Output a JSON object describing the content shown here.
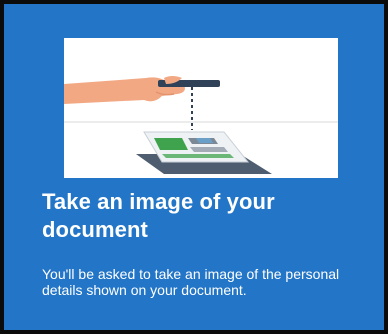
{
  "screen": {
    "title": "Take an image of your document",
    "description": "You'll be asked to take an image of the personal details shown on your document."
  },
  "illustration": {
    "icon": "hand-holding-phone-over-document-icon"
  },
  "colors": {
    "background": "#2275c7",
    "frame_border": "#0b0b0b",
    "text": "#ffffff",
    "skin": "#f2a983",
    "phone": "#2f4257",
    "document_green": "#3fa34d"
  }
}
